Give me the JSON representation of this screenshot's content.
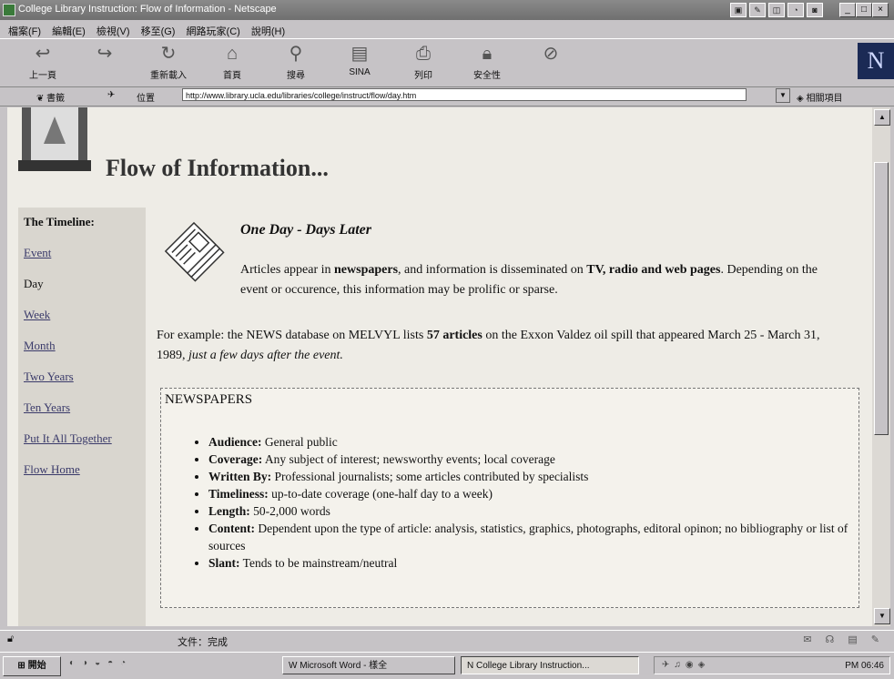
{
  "window": {
    "title": "College Library Instruction: Flow of Information - Netscape"
  },
  "menu": [
    "檔案(F)",
    "編輯(E)",
    "檢視(V)",
    "移至(G)",
    "網路玩家(C)",
    "說明(H)"
  ],
  "toolbar": {
    "buttons": [
      {
        "label": "上一頁",
        "icon": "back-icon"
      },
      {
        "label": "",
        "icon": "forward-icon"
      },
      {
        "label": "重新載入",
        "icon": "reload-icon"
      },
      {
        "label": "首頁",
        "icon": "home-icon"
      },
      {
        "label": "搜尋",
        "icon": "search-icon"
      },
      {
        "label": "SINA",
        "icon": "sina-icon"
      },
      {
        "label": "列印",
        "icon": "print-icon"
      },
      {
        "label": "安全性",
        "icon": "security-icon"
      },
      {
        "label": "",
        "icon": "stop-icon"
      }
    ],
    "logo_text": "N"
  },
  "location": {
    "bookmarks_label": "書籤",
    "location_label": "位置",
    "url": "http://www.library.ucla.edu/libraries/college/instruct/flow/day.htm",
    "related_label": "相關項目"
  },
  "page": {
    "title": "Flow of Information...",
    "timeline": {
      "heading": "The Timeline:",
      "items": [
        "Event",
        "Day",
        "Week",
        "Month",
        "Two Years",
        "Ten Years",
        "Put It All Together",
        "Flow Home"
      ]
    },
    "subhead": "One Day - Days Later",
    "intro": {
      "part1": "Articles appear in ",
      "b1": "newspapers",
      "part2": ", and information is disseminated on ",
      "b2": "TV, radio and web pages",
      "part3": ". Depending on the event or occurence, this information may be prolific or sparse."
    },
    "example": {
      "part1": "For example: the NEWS database on MELVYL lists ",
      "b1": "57 articles",
      "part2": " on the Exxon Valdez oil spill that appeared March 25 - March 31, 1989, ",
      "italic": "just a few days after the event."
    },
    "newspapers": {
      "heading": "NEWSPAPERS",
      "items": [
        {
          "label": "Audience:",
          "text": " General public"
        },
        {
          "label": "Coverage:",
          "text": " Any subject of interest; newsworthy events; local coverage"
        },
        {
          "label": "Written By:",
          "text": " Professional journalists; some articles contributed by specialists"
        },
        {
          "label": "Timeliness:",
          "text": " up-to-date coverage (one-half day to a week)"
        },
        {
          "label": "Length:",
          "text": " 50-2,000 words"
        },
        {
          "label": "Content:",
          "text": " Dependent upon the type of article: analysis, statistics, graphics, photographs, editoral opinon; no bibliography or list of sources"
        },
        {
          "label": "Slant:",
          "text": " Tends to be mainstream/neutral"
        }
      ]
    }
  },
  "status": {
    "text": "文件：完成"
  },
  "taskbar": {
    "start_label": "開始",
    "tasks": [
      "Microsoft Word - 樣全",
      "College Library Instruction..."
    ],
    "clock": "PM 06:46"
  }
}
